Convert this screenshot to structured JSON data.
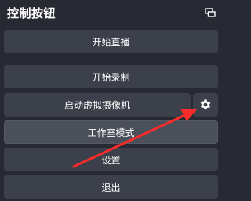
{
  "panel": {
    "title": "控制按钮"
  },
  "buttons": {
    "start_stream": "开始直播",
    "start_record": "开始录制",
    "start_virtual_camera": "启动虚拟摄像机",
    "studio_mode": "工作室模式",
    "settings": "设置",
    "exit": "退出"
  },
  "icons": {
    "undock": "undock-icon",
    "gear": "gear-icon"
  },
  "colors": {
    "background": "#272a33",
    "button": "#3c404b",
    "button_active": "#4b4f5a",
    "arrow": "#ff2a2a"
  }
}
